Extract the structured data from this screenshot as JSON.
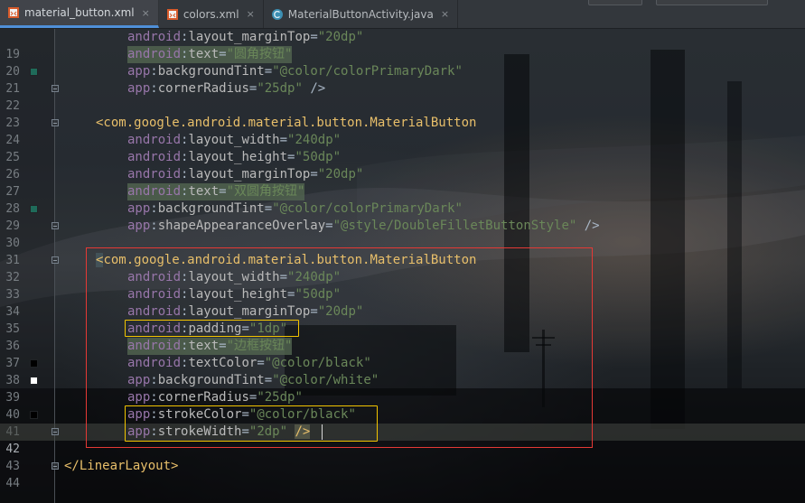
{
  "tabs": [
    {
      "label": "material_button.xml",
      "icon": "xml-file-icon",
      "active": true
    },
    {
      "label": "colors.xml",
      "icon": "xml-file-icon",
      "active": false
    },
    {
      "label": "MaterialButtonActivity.java",
      "icon": "java-class-icon",
      "active": false
    }
  ],
  "close_glyph": "×",
  "lines": [
    {
      "num": "19",
      "text": "android:layout_marginTop=\"20dp\""
    },
    {
      "num": "20",
      "text": "android:text=\"圆角按钮\""
    },
    {
      "num": "21",
      "text": "app:backgroundTint=\"@color/colorPrimaryDark\"",
      "swatch": "#1f6b5a"
    },
    {
      "num": "22",
      "text": "app:cornerRadius=\"25dp\" />"
    },
    {
      "num": "23",
      "text": ""
    },
    {
      "num": "24",
      "text": "<com.google.android.material.button.MaterialButton"
    },
    {
      "num": "25",
      "text": "android:layout_width=\"240dp\""
    },
    {
      "num": "26",
      "text": "android:layout_height=\"50dp\""
    },
    {
      "num": "27",
      "text": "android:layout_marginTop=\"20dp\""
    },
    {
      "num": "28",
      "text": "android:text=\"双圆角按钮\""
    },
    {
      "num": "29",
      "text": "app:backgroundTint=\"@color/colorPrimaryDark\"",
      "swatch": "#1f6b5a"
    },
    {
      "num": "30",
      "text": "app:shapeAppearanceOverlay=\"@style/DoubleFilletButtonStyle\" />"
    },
    {
      "num": "31",
      "text": ""
    },
    {
      "num": "32",
      "text": "<com.google.android.material.button.MaterialButton"
    },
    {
      "num": "33",
      "text": "android:layout_width=\"240dp\""
    },
    {
      "num": "34",
      "text": "android:layout_height=\"50dp\""
    },
    {
      "num": "35",
      "text": "android:layout_marginTop=\"20dp\""
    },
    {
      "num": "36",
      "text": "android:padding=\"1dp\""
    },
    {
      "num": "37",
      "text": "android:text=\"边框按钮\""
    },
    {
      "num": "38",
      "text": "android:textColor=\"@color/black\"",
      "swatch": "#000000"
    },
    {
      "num": "39",
      "text": "app:backgroundTint=\"@color/white\"",
      "swatch": "#ffffff"
    },
    {
      "num": "40",
      "text": "app:cornerRadius=\"25dp\""
    },
    {
      "num": "41",
      "text": "app:strokeColor=\"@color/black\"",
      "swatch": "#000000"
    },
    {
      "num": "42",
      "text": "app:strokeWidth=\"2dp\" />"
    },
    {
      "num": "43",
      "text": ""
    },
    {
      "num": "44",
      "text": "</LinearLayout>"
    }
  ],
  "colors": {
    "red_box": "#e53935",
    "yellow_box": "#f2c400",
    "active_tab_underline": "#4f8fd8"
  }
}
